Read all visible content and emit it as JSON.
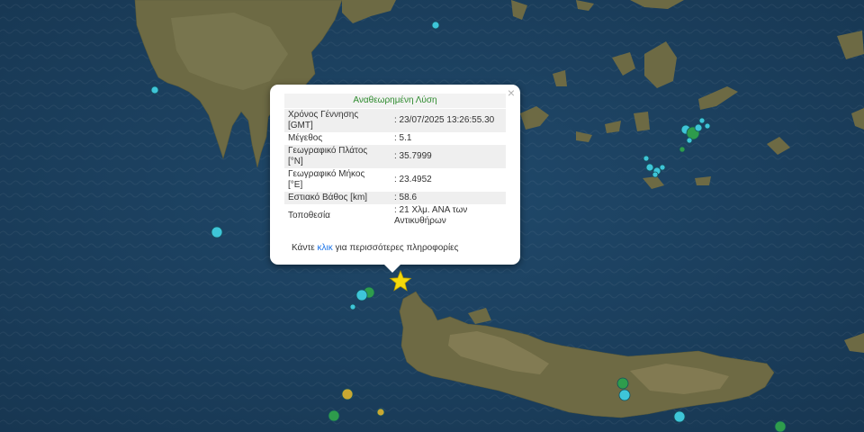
{
  "popup": {
    "title": "Αναθεωρημένη Λύση",
    "close": "×",
    "rows": [
      {
        "label": "Χρόνος Γέννησης [GMT]",
        "value": ": 23/07/2025 13:26:55.30"
      },
      {
        "label": "Μέγεθος",
        "value": ": 5.1"
      },
      {
        "label": "Γεωγραφικό Πλάτος [°N]",
        "value": ": 35.7999"
      },
      {
        "label": "Γεωγραφικό Μήκος [°E]",
        "value": ": 23.4952"
      },
      {
        "label": "Εστιακό Βάθος [km]",
        "value": ": 58.6"
      },
      {
        "label": "Τοποθεσία",
        "value": ": 21 Χλμ. ΑΝΑ των Αντικυθήρων"
      }
    ],
    "more_prefix": "Κάντε",
    "more_link": "κλικ",
    "more_suffix": "για περισσότερες πληροφορίες"
  },
  "colors": {
    "sea": "#1d3f5e",
    "land": "#6b6a45",
    "star": "#f5d90a",
    "quake_recent": "#3ec5d8",
    "quake_older": "#2e9c4c",
    "quake_oldest": "#c9a832"
  },
  "epicenter_icon": "star-icon"
}
